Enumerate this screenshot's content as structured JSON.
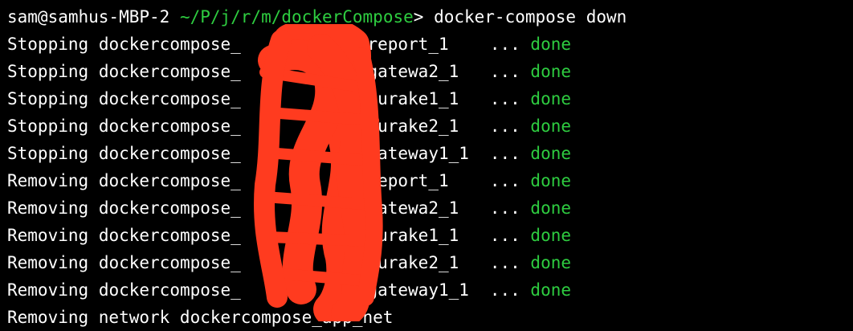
{
  "terminal": {
    "prompt": {
      "user_host": "sam@samhus-MBP-2",
      "path": "~/P/j/r/m/dockerCompose",
      "symbol": ">",
      "command": "docker-compose down"
    },
    "lines": [
      {
        "action": "Stopping",
        "prefix": "dockercompose_",
        "suffix": "-report_1",
        "dots": "...",
        "status": "done"
      },
      {
        "action": "Stopping",
        "prefix": "dockercompose_",
        "suffix": "-gatewa2_1",
        "dots": "...",
        "status": "done"
      },
      {
        "action": "Stopping",
        "prefix": "dockercompose_",
        "suffix": "-eurake1_1",
        "dots": "...",
        "status": "done"
      },
      {
        "action": "Stopping",
        "prefix": "dockercompose_",
        "suffix": "-eurake2_1",
        "dots": "...",
        "status": "done"
      },
      {
        "action": "Stopping",
        "prefix": "dockercompose_",
        "suffix": "-gateway1_1",
        "dots": "...",
        "status": "done"
      },
      {
        "action": "Removing",
        "prefix": "dockercompose_",
        "suffix": "-report_1",
        "dots": "...",
        "status": "done"
      },
      {
        "action": "Removing",
        "prefix": "dockercompose_",
        "suffix": "-gatewa2_1",
        "dots": "...",
        "status": "done"
      },
      {
        "action": "Removing",
        "prefix": "dockercompose_",
        "suffix": "-eurake1_1",
        "dots": "...",
        "status": "done"
      },
      {
        "action": "Removing",
        "prefix": "dockercompose_",
        "suffix": "-eurake2_1",
        "dots": "...",
        "status": "done"
      },
      {
        "action": "Removing",
        "prefix": "dockercompose_",
        "suffix": "-gateway1_1",
        "dots": "...",
        "status": "done"
      }
    ],
    "network_line": "Removing network dockercompose_app_net"
  },
  "colors": {
    "background": "#000000",
    "text": "#ffffff",
    "accent_green": "#2ecc40",
    "redaction_red": "#ff3b1f"
  }
}
